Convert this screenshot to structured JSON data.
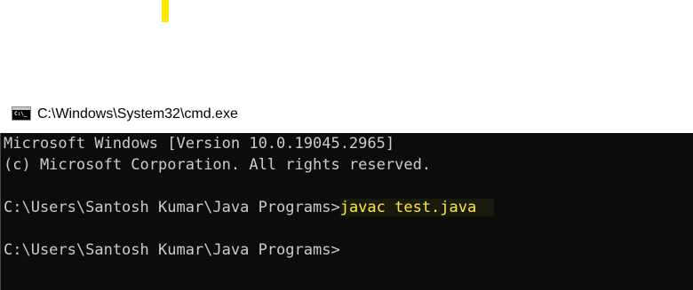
{
  "window": {
    "title": "C:\\Windows\\System32\\cmd.exe",
    "icon": "cmd-icon",
    "icon_text": "C:\\_"
  },
  "console": {
    "line1": "Microsoft Windows [Version 10.0.19045.2965]",
    "line2": "(c) Microsoft Corporation. All rights reserved.",
    "prompt1": "C:\\Users\\Santosh Kumar\\Java Programs>",
    "command1": "javac test.java",
    "prompt2": "C:\\Users\\Santosh Kumar\\Java Programs>"
  },
  "colors": {
    "console_bg": "#0c0c0c",
    "console_text": "#cccccc",
    "command_highlight_text": "#ffeb3b",
    "highlight_mark": "#ffeb00"
  }
}
